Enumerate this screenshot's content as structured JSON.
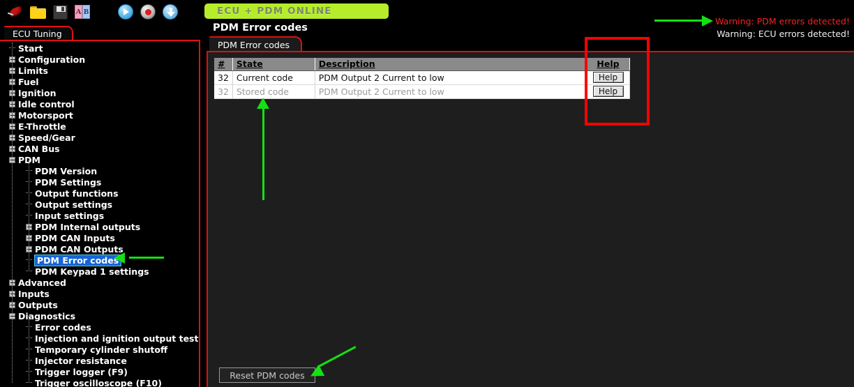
{
  "toolbar": {
    "icons": [
      {
        "name": "tune-feather-icon",
        "label": "Tune"
      },
      {
        "name": "open-folder-icon",
        "label": "Open"
      },
      {
        "name": "save-floppy-icon",
        "label": "Save"
      },
      {
        "name": "compare-ab-icon",
        "label": "A B"
      },
      {
        "name": "play-icon",
        "label": "Play"
      },
      {
        "name": "record-icon",
        "label": "Record"
      },
      {
        "name": "download-icon",
        "label": "Download"
      }
    ],
    "ab_a": "A",
    "ab_b": "B"
  },
  "status": {
    "online_badge": "ECU + PDM ONLINE",
    "online_badge_color": "#b6ed2a"
  },
  "header": {
    "page_title": "PDM Error codes"
  },
  "warnings": {
    "pdm": "Warning: PDM errors detected!",
    "pdm_color": "#f22222",
    "ecu": "Warning: ECU errors detected!",
    "ecu_color": "#f0f0f0"
  },
  "sidebar": {
    "tab_label": "ECU Tuning",
    "items": [
      {
        "label": "Start",
        "level": 1,
        "state": "leaf"
      },
      {
        "label": "Configuration",
        "level": 1,
        "state": "collapsed"
      },
      {
        "label": "Limits",
        "level": 1,
        "state": "collapsed"
      },
      {
        "label": "Fuel",
        "level": 1,
        "state": "collapsed"
      },
      {
        "label": "Ignition",
        "level": 1,
        "state": "collapsed"
      },
      {
        "label": "Idle control",
        "level": 1,
        "state": "collapsed"
      },
      {
        "label": "Motorsport",
        "level": 1,
        "state": "collapsed"
      },
      {
        "label": "E-Throttle",
        "level": 1,
        "state": "collapsed"
      },
      {
        "label": "Speed/Gear",
        "level": 1,
        "state": "collapsed"
      },
      {
        "label": "CAN Bus",
        "level": 1,
        "state": "collapsed"
      },
      {
        "label": "PDM",
        "level": 1,
        "state": "expanded"
      },
      {
        "label": "PDM Version",
        "level": 2,
        "state": "leaf"
      },
      {
        "label": "PDM Settings",
        "level": 2,
        "state": "leaf"
      },
      {
        "label": "Output functions",
        "level": 2,
        "state": "leaf"
      },
      {
        "label": "Output settings",
        "level": 2,
        "state": "leaf"
      },
      {
        "label": "Input settings",
        "level": 2,
        "state": "leaf"
      },
      {
        "label": "PDM Internal outputs",
        "level": 2,
        "state": "collapsed"
      },
      {
        "label": "PDM CAN Inputs",
        "level": 2,
        "state": "collapsed"
      },
      {
        "label": "PDM CAN Outputs",
        "level": 2,
        "state": "collapsed"
      },
      {
        "label": "PDM Error codes",
        "level": 2,
        "state": "leaf",
        "selected": true
      },
      {
        "label": "PDM Keypad 1 settings",
        "level": 2,
        "state": "leaf"
      },
      {
        "label": "Advanced",
        "level": 1,
        "state": "collapsed"
      },
      {
        "label": "Inputs",
        "level": 1,
        "state": "collapsed"
      },
      {
        "label": "Outputs",
        "level": 1,
        "state": "collapsed"
      },
      {
        "label": "Diagnostics",
        "level": 1,
        "state": "expanded"
      },
      {
        "label": "Error codes",
        "level": 2,
        "state": "leaf"
      },
      {
        "label": "Injection and ignition output test",
        "level": 2,
        "state": "leaf"
      },
      {
        "label": "Temporary cylinder shutoff",
        "level": 2,
        "state": "leaf"
      },
      {
        "label": "Injector resistance",
        "level": 2,
        "state": "leaf"
      },
      {
        "label": "Trigger logger (F9)",
        "level": 2,
        "state": "leaf"
      },
      {
        "label": "Trigger oscilloscope (F10)",
        "level": 2,
        "state": "leaf"
      }
    ]
  },
  "main": {
    "tab_label": "PDM Error codes",
    "table": {
      "columns": [
        "#",
        "State",
        "Description",
        "Help"
      ],
      "rows": [
        {
          "num": "32",
          "state": "Current code",
          "description": "PDM Output 2 Current to low",
          "help": "Help",
          "dim": false
        },
        {
          "num": "32",
          "state": "Stored code",
          "description": "PDM Output 2 Current to low",
          "help": "Help",
          "dim": true
        }
      ]
    },
    "reset_button": "Reset PDM codes"
  },
  "annotations": {
    "color": "#14e014",
    "rect_color": "#ff0000",
    "items": [
      {
        "name": "arrow-to-pdm-warning",
        "direction": "right"
      },
      {
        "name": "arrow-to-sidebar-pdm-error-codes",
        "direction": "left"
      },
      {
        "name": "arrow-to-error-table",
        "direction": "up"
      },
      {
        "name": "arrow-to-reset-button",
        "direction": "left-down"
      },
      {
        "name": "highlight-rect-help-column",
        "shape": "rectangle"
      }
    ]
  }
}
